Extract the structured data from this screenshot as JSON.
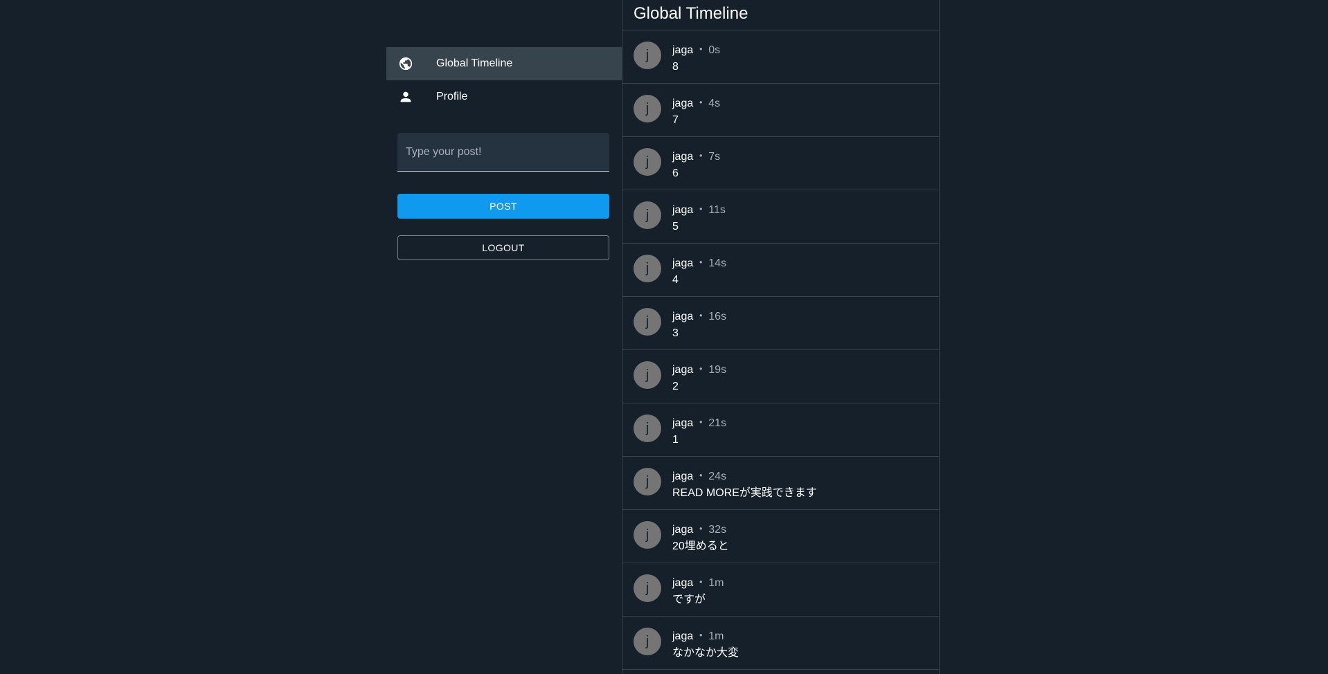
{
  "nav": {
    "items": [
      {
        "label": "Global Timeline",
        "icon": "globe-icon",
        "active": true
      },
      {
        "label": "Profile",
        "icon": "person-icon",
        "active": false
      }
    ]
  },
  "composer": {
    "placeholder": "Type your post!",
    "value": "",
    "post_label": "POST",
    "logout_label": "LOGOUT"
  },
  "timeline": {
    "title": "Global Timeline",
    "separator": "・",
    "posts": [
      {
        "avatar": "j",
        "user": "jaga",
        "time": "0s",
        "text": "8"
      },
      {
        "avatar": "j",
        "user": "jaga",
        "time": "4s",
        "text": "7"
      },
      {
        "avatar": "j",
        "user": "jaga",
        "time": "7s",
        "text": "6"
      },
      {
        "avatar": "j",
        "user": "jaga",
        "time": "11s",
        "text": "5"
      },
      {
        "avatar": "j",
        "user": "jaga",
        "time": "14s",
        "text": "4"
      },
      {
        "avatar": "j",
        "user": "jaga",
        "time": "16s",
        "text": "3"
      },
      {
        "avatar": "j",
        "user": "jaga",
        "time": "19s",
        "text": "2"
      },
      {
        "avatar": "j",
        "user": "jaga",
        "time": "21s",
        "text": "1"
      },
      {
        "avatar": "j",
        "user": "jaga",
        "time": "24s",
        "text": "READ MOREが実践できます"
      },
      {
        "avatar": "j",
        "user": "jaga",
        "time": "32s",
        "text": "20埋めると"
      },
      {
        "avatar": "j",
        "user": "jaga",
        "time": "1m",
        "text": "ですが"
      },
      {
        "avatar": "j",
        "user": "jaga",
        "time": "1m",
        "text": "なかなか大変"
      }
    ]
  },
  "colors": {
    "background": "#15202b",
    "accent": "#0f9af0",
    "nav_active": "#38444d",
    "avatar": "#757575"
  }
}
